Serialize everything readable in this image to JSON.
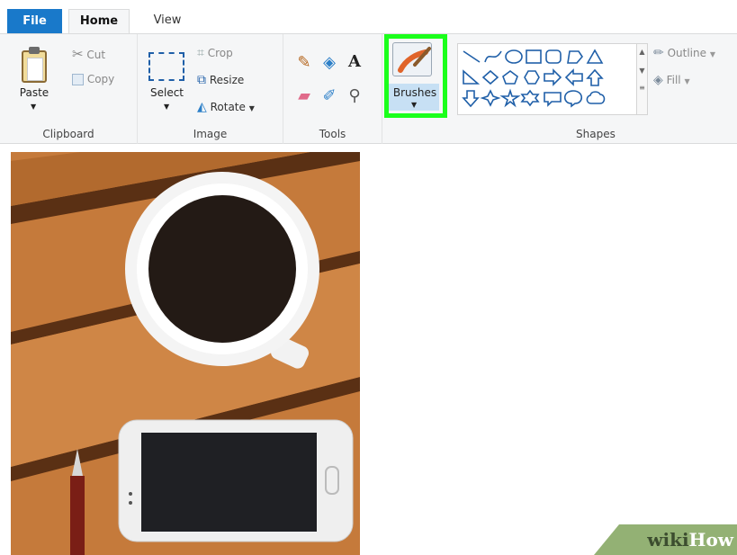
{
  "tabs": {
    "file": "File",
    "home": "Home",
    "view": "View"
  },
  "clipboard": {
    "paste": "Paste",
    "cut": "Cut",
    "copy": "Copy",
    "group_label": "Clipboard"
  },
  "image": {
    "select": "Select",
    "crop": "Crop",
    "resize": "Resize",
    "rotate": "Rotate",
    "group_label": "Image"
  },
  "tools": {
    "text_tool": "A",
    "group_label": "Tools"
  },
  "brushes": {
    "label": "Brushes",
    "highlight_color": "#1bff1b"
  },
  "shapes": {
    "outline": "Outline",
    "fill": "Fill",
    "group_label": "Shapes"
  },
  "watermark": {
    "wiki": "wiki",
    "how": "How"
  },
  "colors": {
    "file_tab": "#1979ca",
    "ribbon_bg": "#f5f6f7",
    "shape_stroke": "#1f5fa8"
  }
}
